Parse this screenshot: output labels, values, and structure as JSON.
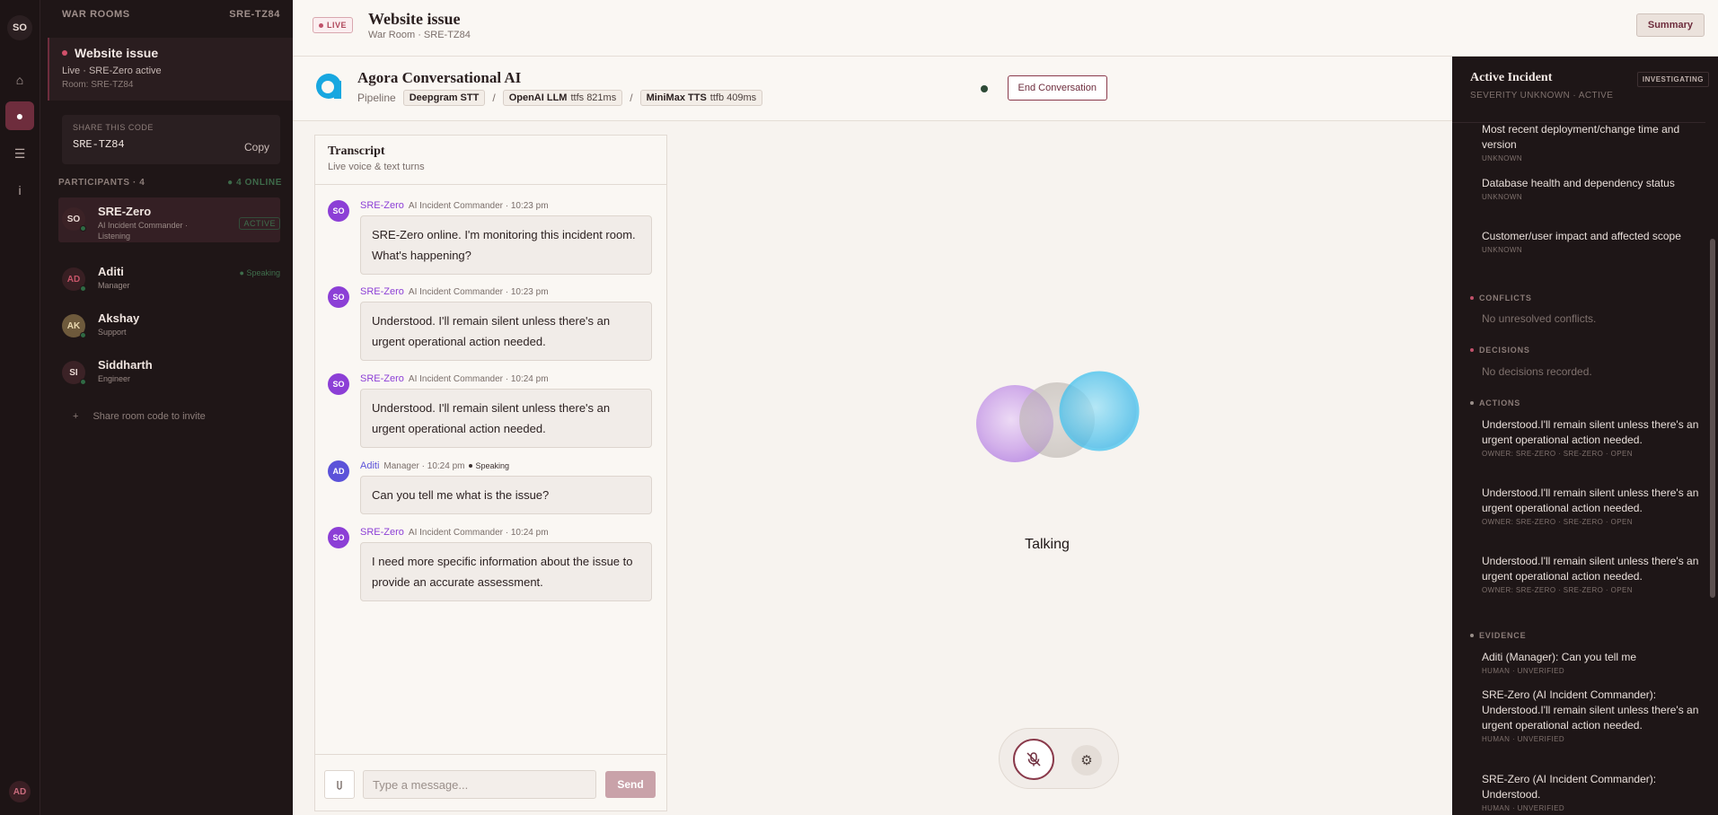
{
  "rail": {
    "brand": "SO",
    "me": "AD"
  },
  "sidebar": {
    "heading": "WAR ROOMS",
    "room_code_label": "SRE-TZ84",
    "active_room": {
      "title": "Website issue",
      "status": "Live · SRE-Zero active",
      "room": "Room: SRE-TZ84"
    },
    "share": {
      "label": "SHARE THIS CODE",
      "code": "SRE-TZ84",
      "copy": "Copy"
    },
    "participants_heading": "PARTICIPANTS · 4",
    "online": "● 4 ONLINE",
    "participants": [
      {
        "initials": "SO",
        "name": "SRE-Zero",
        "role": "AI Incident Commander · Listening",
        "badge": "ACTIVE"
      },
      {
        "initials": "AD",
        "name": "Aditi",
        "role": "Manager",
        "status": "● Speaking"
      },
      {
        "initials": "AK",
        "name": "Akshay",
        "role": "Support"
      },
      {
        "initials": "SI",
        "name": "Siddharth",
        "role": "Engineer"
      }
    ],
    "invite": "Share room code to invite"
  },
  "header": {
    "live": "LIVE",
    "title": "Website issue",
    "subtitle": "War Room · SRE-TZ84",
    "summary": "Summary"
  },
  "agent": {
    "name": "Agora Conversational AI",
    "pipeline_label": "Pipeline",
    "chips": [
      {
        "name": "Deepgram STT",
        "metric": ""
      },
      {
        "name": "OpenAI LLM",
        "metric": "ttfs 821ms"
      },
      {
        "name": "MiniMax TTS",
        "metric": "ttfb 409ms"
      }
    ],
    "end": "End Conversation"
  },
  "transcript": {
    "title": "Transcript",
    "subtitle": "Live voice & text turns",
    "messages": [
      {
        "initials": "SO",
        "name": "SRE-Zero",
        "meta": "AI Incident Commander · 10:23 pm",
        "text": "SRE-Zero online. I'm monitoring this incident room. What's happening?"
      },
      {
        "initials": "SO",
        "name": "SRE-Zero",
        "meta": "AI Incident Commander · 10:23 pm",
        "text": "Understood. I'll remain silent unless there's an urgent operational action needed."
      },
      {
        "initials": "SO",
        "name": "SRE-Zero",
        "meta": "AI Incident Commander · 10:24 pm",
        "text": "Understood. I'll remain silent unless there's an urgent operational action needed."
      },
      {
        "initials": "AD",
        "name": "Aditi",
        "meta": "Manager · 10:24 pm",
        "speaking": "Speaking",
        "text": "Can you tell me what is the issue?"
      },
      {
        "initials": "SO",
        "name": "SRE-Zero",
        "meta": "AI Incident Commander · 10:24 pm",
        "text": "I need more specific information about the issue to provide an accurate assessment."
      }
    ],
    "placeholder": "Type a message...",
    "send": "Send"
  },
  "voice": {
    "state": "Talking"
  },
  "incident": {
    "title": "Active Incident",
    "badge": "INVESTIGATING",
    "subtitle": "SEVERITY UNKNOWN · ACTIVE",
    "questions": [
      {
        "text": "Most recent deployment/change time and version",
        "meta": "UNKNOWN"
      },
      {
        "text": "Database health and dependency status",
        "meta": "UNKNOWN"
      },
      {
        "text": "Customer/user impact and affected scope",
        "meta": "UNKNOWN"
      }
    ],
    "conflicts_heading": "CONFLICTS",
    "conflicts_empty": "No unresolved conflicts.",
    "decisions_heading": "DECISIONS",
    "decisions_empty": "No decisions recorded.",
    "actions_heading": "ACTIONS",
    "actions": [
      {
        "text": "Understood.I'll remain silent unless there's an urgent operational action needed.",
        "meta": "OWNER: SRE-ZERO · SRE-ZERO · OPEN"
      },
      {
        "text": "Understood.I'll remain silent unless there's an urgent operational action needed.",
        "meta": "OWNER: SRE-ZERO · SRE-ZERO · OPEN"
      },
      {
        "text": "Understood.I'll remain silent unless there's an urgent operational action needed.",
        "meta": "OWNER: SRE-ZERO · SRE-ZERO · OPEN"
      }
    ],
    "evidence_heading": "EVIDENCE",
    "evidence": [
      {
        "text": "Aditi (Manager): Can you tell me",
        "meta": "HUMAN · UNVERIFIED"
      },
      {
        "text": "SRE-Zero (AI Incident Commander): Understood.I'll remain silent unless there's an urgent operational action needed.",
        "meta": "HUMAN · UNVERIFIED"
      },
      {
        "text": "SRE-Zero (AI Incident Commander): Understood.",
        "meta": "HUMAN · UNVERIFIED"
      }
    ]
  },
  "colors": {
    "accent": "#6e2d3d",
    "purple": "#8c3fd6",
    "indigo": "#5b52d9",
    "sidebar": "#1f1617"
  }
}
